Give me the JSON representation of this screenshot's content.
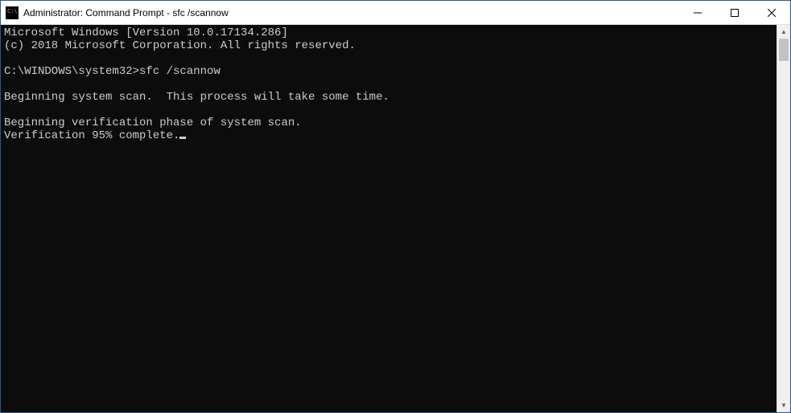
{
  "window": {
    "title": "Administrator: Command Prompt - sfc  /scannow"
  },
  "console": {
    "line1": "Microsoft Windows [Version 10.0.17134.286]",
    "line2": "(c) 2018 Microsoft Corporation. All rights reserved.",
    "blank1": "",
    "prompt_line": "C:\\WINDOWS\\system32>sfc /scannow",
    "blank2": "",
    "line3": "Beginning system scan.  This process will take some time.",
    "blank3": "",
    "line4": "Beginning verification phase of system scan.",
    "line5": "Verification 95% complete."
  }
}
